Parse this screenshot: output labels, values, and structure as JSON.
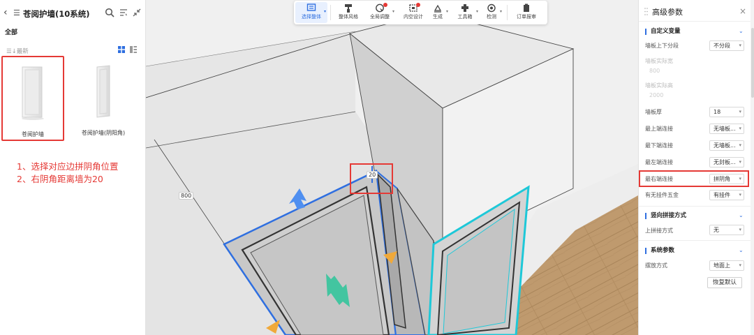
{
  "left_panel": {
    "title": "苍阅护墙(10系统)",
    "category_all": "全部",
    "sort_label": "最新",
    "items": [
      {
        "label": "苍阅护墙",
        "selected": true
      },
      {
        "label": "苍阅护墙(阴阳角)",
        "selected": false
      }
    ],
    "annotations": [
      "1、选择对应边拼阴角位置",
      "2、右阴角距离墙为20"
    ],
    "icons": [
      "back-icon",
      "list-icon",
      "search-icon",
      "filter-icon",
      "collapse-icon",
      "sort-icon",
      "grid-view-icon",
      "list-view-icon"
    ]
  },
  "toolbar": {
    "buttons": [
      {
        "label": "选择整体",
        "icon": "select-icon",
        "active": true,
        "caret": true
      },
      {
        "label": "整体风格",
        "icon": "brush-icon"
      },
      {
        "label": "全局调整",
        "icon": "globe-adjust-icon",
        "badge": true,
        "caret": true
      },
      {
        "label": "内空设计",
        "icon": "inner-design-icon",
        "badge": true
      },
      {
        "label": "生成",
        "icon": "generate-icon",
        "caret": true
      },
      {
        "label": "工具箱",
        "icon": "toolbox-icon",
        "caret": true
      },
      {
        "label": "检测",
        "icon": "detect-icon",
        "caret": true
      },
      {
        "label": "订单报审",
        "icon": "order-review-icon"
      }
    ]
  },
  "viewport": {
    "dimension_left": "800",
    "dimension_top": "20"
  },
  "right_panel": {
    "title": "高级参数",
    "close": "×",
    "sections": [
      {
        "title": "自定义变量",
        "rows": [
          {
            "label": "墙板上下分段",
            "value": "不分段",
            "type": "select"
          },
          {
            "label": "墙板实际宽",
            "value": "800",
            "type": "readonly"
          },
          {
            "label": "墙板实际高",
            "value": "2000",
            "type": "readonly"
          },
          {
            "label": "墙板厚",
            "value": "18",
            "type": "select"
          },
          {
            "label": "最上端连接",
            "value": "无墙板...",
            "type": "select"
          },
          {
            "label": "最下端连接",
            "value": "无墙板...",
            "type": "select"
          },
          {
            "label": "最左端连接",
            "value": "无封板...",
            "type": "select"
          },
          {
            "label": "最右端连接",
            "value": "拼阴角",
            "type": "select",
            "highlighted": true
          },
          {
            "label": "有无挂件五金",
            "value": "有挂件",
            "type": "select"
          }
        ]
      },
      {
        "title": "竖向拼接方式",
        "rows": [
          {
            "label": "上拼接方式",
            "value": "无",
            "type": "select"
          }
        ]
      },
      {
        "title": "系统参数",
        "rows": [
          {
            "label": "摆放方式",
            "value": "地面上",
            "type": "select"
          }
        ]
      }
    ],
    "reset_label": "恢复默认"
  }
}
